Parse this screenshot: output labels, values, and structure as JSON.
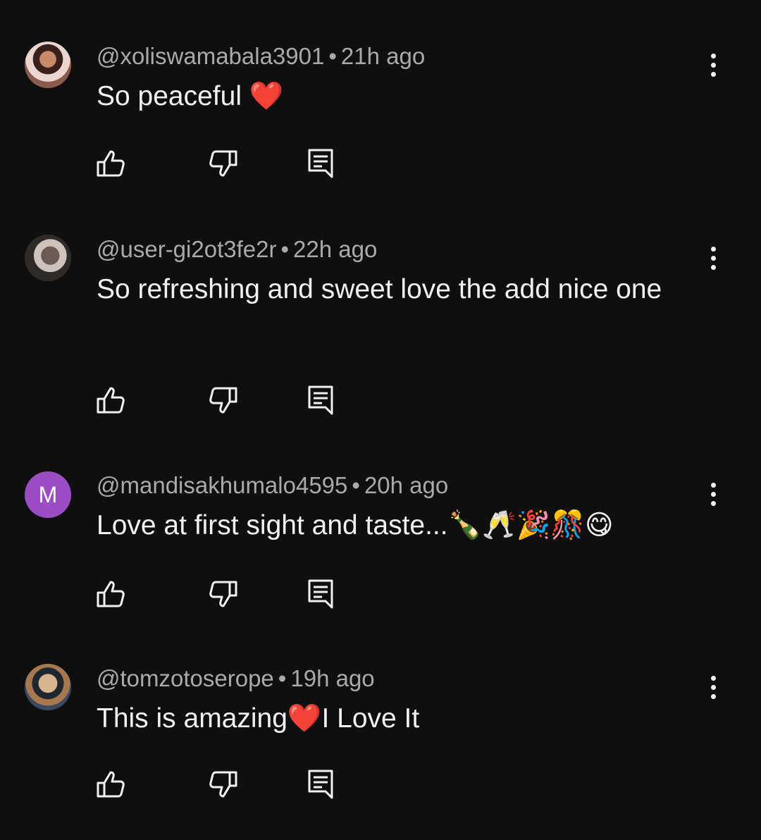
{
  "comments": [
    {
      "handle": "@xoliswamabala3901",
      "separator": "•",
      "time": "21h ago",
      "text": "So peaceful ❤️",
      "avatar_type": "photo"
    },
    {
      "handle": "@user-gi2ot3fe2r",
      "separator": "•",
      "time": "22h ago",
      "text": "So refreshing and sweet love the add nice one",
      "avatar_type": "photo"
    },
    {
      "handle": "@mandisakhumalo4595",
      "separator": "•",
      "time": "20h ago",
      "text": "Love at first sight and taste...🍾🥂🎉🎊😋",
      "avatar_type": "letter",
      "avatar_letter": "M",
      "avatar_color": "#9c4cc4"
    },
    {
      "handle": "@tomzotoserope",
      "separator": "•",
      "time": "19h ago",
      "text": "This is amazing❤️I Love It",
      "avatar_type": "photo"
    }
  ],
  "icons": {
    "like": "thumbs-up-icon",
    "dislike": "thumbs-down-icon",
    "reply": "reply-comment-icon",
    "menu": "more-vertical-icon"
  },
  "colors": {
    "background": "#0f0f0f",
    "text": "#f1f1f1",
    "meta": "#aaaaaa"
  }
}
